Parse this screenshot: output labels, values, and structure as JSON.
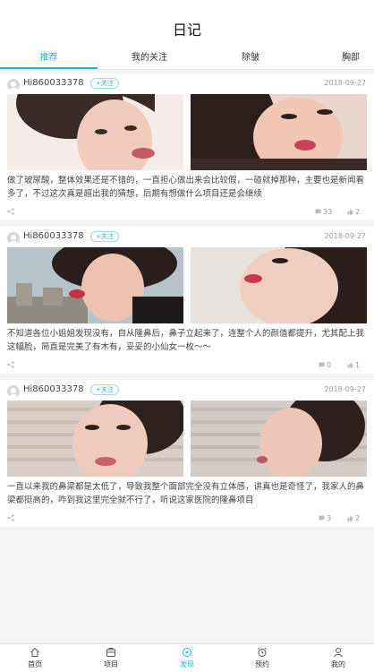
{
  "header": {
    "title": "日记"
  },
  "tabs": [
    {
      "label": "推荐"
    },
    {
      "label": "我的关注"
    },
    {
      "label": "除皱"
    },
    {
      "label": "胸部"
    }
  ],
  "posts": [
    {
      "username": "Hi860033378",
      "follow": "+关注",
      "date": "2018-09-27",
      "text": "做了玻尿酸，整体效果还是不错的，一直担心做出来会比较假，一碰就掉那种，主要也是新闻看多了，不过这次真是超出我的猜想，后期有想做什么项目还是会继续",
      "comments": "33",
      "likes": "2"
    },
    {
      "username": "Hi860033378",
      "follow": "+关注",
      "date": "2018-09-27",
      "text": "不知道各位小姐姐发现没有，自从隆鼻后，鼻子立起来了，连整个人的颜值都提升，尤其配上我这幅脸，简直是完美了有木有，妥妥的小仙女一枚～～",
      "comments": "0",
      "likes": "1"
    },
    {
      "username": "Hi860033378",
      "follow": "+关注",
      "date": "2018-09-27",
      "text": "一直以来我的鼻梁都是太低了，导致我整个面部完全没有立体感，讲真也是奇怪了，我家人的鼻梁都挺高的，咋到我这里完全就不行了，听说这家医院的隆鼻项目",
      "comments": "3",
      "likes": "2"
    }
  ],
  "bottom_nav": [
    {
      "label": "首页",
      "icon": "home-icon"
    },
    {
      "label": "项目",
      "icon": "project-icon"
    },
    {
      "label": "发现",
      "icon": "discover-icon"
    },
    {
      "label": "预约",
      "icon": "alarm-icon"
    },
    {
      "label": "我的",
      "icon": "person-icon"
    }
  ],
  "colors": {
    "accent": "#2fb0d8",
    "background": "#f4f4f4"
  }
}
